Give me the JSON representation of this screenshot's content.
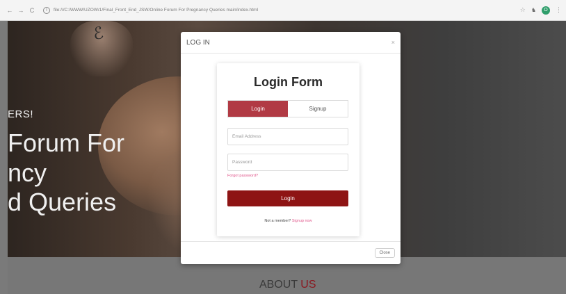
{
  "browser": {
    "url": "file:///C:/WWW/UZOW/1/Final_Front_End_JSW/Online Forum For Pregnancy Queries main/index.html",
    "nav_back": "←",
    "nav_forward": "→",
    "nav_reload": "C",
    "info": "i",
    "star": "☆",
    "extension": "♞",
    "profile_initial": "O",
    "menu": "⋮"
  },
  "hero": {
    "line1": "ERS!",
    "line2": "Forum For",
    "line3": "ncy",
    "line4": "d Queries"
  },
  "about": {
    "word1": "ABOUT ",
    "word2": "US"
  },
  "modal": {
    "title": "LOG IN",
    "close_x": "×",
    "close_button": "Close",
    "form_title": "Login Form",
    "tabs": [
      "Login",
      "Signup"
    ],
    "email_placeholder": "Email Address",
    "password_placeholder": "Password",
    "forgot_link": "Forgot password?",
    "submit_label": "Login",
    "member_text": "Not a member? ",
    "signup_link": "Signup now"
  },
  "colors": {
    "accent": "#8e1414",
    "tab_active": "#b13a44",
    "link": "#e0558a"
  }
}
